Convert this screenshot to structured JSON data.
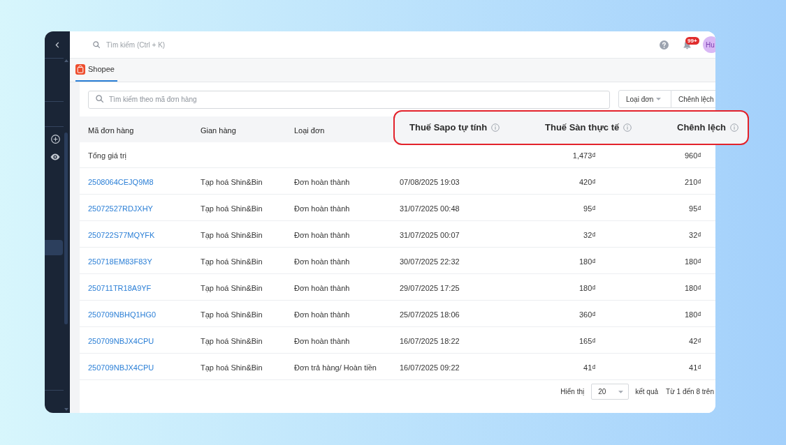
{
  "sidebar": {
    "items": [
      {
        "kind": "add",
        "selected": false
      },
      {
        "kind": "view",
        "selected": false
      },
      {
        "kind": "item",
        "selected": true
      }
    ]
  },
  "top_bar": {
    "search": {
      "placeholder": "Tìm kiếm (Ctrl + K)"
    },
    "notifications": {
      "badge": "99+"
    },
    "avatar": {
      "initials": "Hu"
    }
  },
  "tabs": [
    {
      "label": "Shopee",
      "selected": true
    }
  ],
  "filters": {
    "search": {
      "placeholder": "Tìm kiếm theo mã đơn hàng"
    },
    "buttons": [
      {
        "label": "Loại đơn",
        "kind": "dropdown"
      },
      {
        "label": "Chênh lệch",
        "kind": "plain"
      }
    ]
  },
  "table": {
    "columns": [
      {
        "label": "Mã đơn hàng",
        "highlighted": false
      },
      {
        "label": "Gian hàng",
        "highlighted": false
      },
      {
        "label": "Loại đơn",
        "highlighted": false
      },
      {
        "label": "Thuế Sapo tự tính",
        "highlighted": true
      },
      {
        "label": "Thuế Sàn thực tế",
        "highlighted": true
      },
      {
        "label": "Chênh lệch",
        "highlighted": true
      }
    ],
    "summary_row": {
      "label": "Tổng giá trị",
      "totals": [
        "1,473₫",
        "960₫"
      ]
    },
    "rows": [
      {
        "cells": [
          "2508064CEJQ9M8",
          "Tạp hoá Shin&Bin",
          "Đơn hoàn thành",
          "07/08/2025 19:03",
          "420₫",
          "210₫"
        ]
      },
      {
        "cells": [
          "25072527RDJXHY",
          "Tạp hoá Shin&Bin",
          "Đơn hoàn thành",
          "31/07/2025 00:48",
          "95₫",
          "95₫"
        ]
      },
      {
        "cells": [
          "250722S77MQYFK",
          "Tạp hoá Shin&Bin",
          "Đơn hoàn thành",
          "31/07/2025 00:07",
          "32₫",
          "32₫"
        ]
      },
      {
        "cells": [
          "250718EM83F83Y",
          "Tạp hoá Shin&Bin",
          "Đơn hoàn thành",
          "30/07/2025 22:32",
          "180₫",
          "180₫"
        ]
      },
      {
        "cells": [
          "250711TR18A9YF",
          "Tạp hoá Shin&Bin",
          "Đơn hoàn thành",
          "29/07/2025 17:25",
          "180₫",
          "180₫"
        ]
      },
      {
        "cells": [
          "250709NBHQ1HG0",
          "Tạp hoá Shin&Bin",
          "Đơn hoàn thành",
          "25/07/2025 18:06",
          "360₫",
          "180₫"
        ]
      },
      {
        "cells": [
          "250709NBJX4CPU",
          "Tạp hoá Shin&Bin",
          "Đơn hoàn thành",
          "16/07/2025 18:22",
          "165₫",
          "42₫"
        ]
      },
      {
        "cells": [
          "250709NBJX4CPU",
          "Tạp hoá Shin&Bin",
          "Đơn trả hàng/ Hoàn tiền",
          "16/07/2025 09:22",
          "41₫",
          "41₫"
        ]
      }
    ]
  },
  "pagination": {
    "page_size_label": "Hiển thị",
    "page_size": "20",
    "page_size_suffix": "kết quả",
    "range": "Từ 1 đến 8 trên"
  }
}
